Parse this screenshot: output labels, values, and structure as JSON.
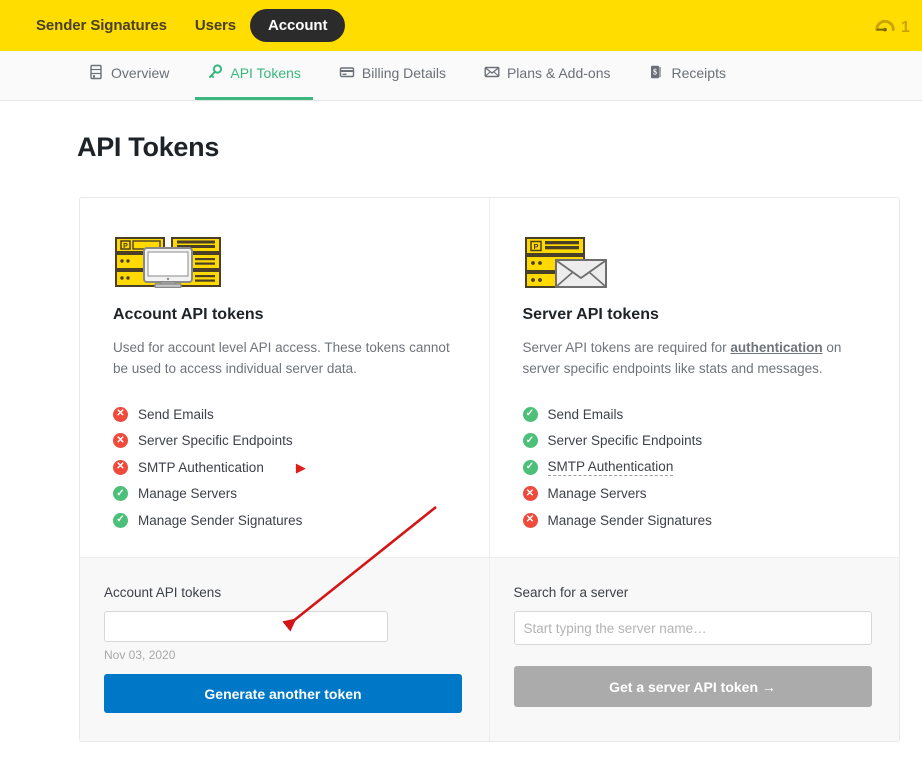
{
  "topbar": {
    "items": [
      {
        "label": "Sender Signatures",
        "active": false
      },
      {
        "label": "Users",
        "active": false
      },
      {
        "label": "Account",
        "active": true
      }
    ],
    "gauge_icon": "gauge-icon",
    "count": "1",
    "bg_color": "#ffdd00",
    "active_pill_color": "#2b2b2b"
  },
  "subnav": {
    "items": [
      {
        "label": "Overview",
        "icon": "server-icon",
        "active": false
      },
      {
        "label": "API Tokens",
        "icon": "key-icon",
        "active": true
      },
      {
        "label": "Billing Details",
        "icon": "credit-card-icon",
        "active": false
      },
      {
        "label": "Plans & Add-ons",
        "icon": "envelope-icon",
        "active": false
      },
      {
        "label": "Receipts",
        "icon": "receipt-icon",
        "active": false
      }
    ],
    "active_color": "#3ab77e"
  },
  "page": {
    "title": "API Tokens"
  },
  "cards": {
    "account": {
      "icon": "servers-with-monitor-icon",
      "title": "Account API tokens",
      "description": "Used for account level API access. These tokens cannot be used to access individual server data.",
      "features": [
        {
          "label": "Send Emails",
          "allowed": false
        },
        {
          "label": "Server Specific Endpoints",
          "allowed": false
        },
        {
          "label": "SMTP Authentication",
          "allowed": false,
          "marker": "▶"
        },
        {
          "label": "Manage Servers",
          "allowed": true
        },
        {
          "label": "Manage Sender Signatures",
          "allowed": true
        }
      ],
      "form": {
        "label": "Account API tokens",
        "token_value": "",
        "token_placeholder": "",
        "date": "Nov 03, 2020",
        "button_label": "Generate another token",
        "button_color": "#0078c8"
      }
    },
    "server": {
      "icon": "servers-with-envelope-icon",
      "title": "Server API tokens",
      "description_before": "Server API tokens are required for ",
      "description_link": "authentication",
      "description_after": " on server specific endpoints like stats and messages.",
      "features": [
        {
          "label": "Send Emails",
          "allowed": true
        },
        {
          "label": "Server Specific Endpoints",
          "allowed": true
        },
        {
          "label": "SMTP Authentication",
          "allowed": true,
          "dotted": true
        },
        {
          "label": "Manage Servers",
          "allowed": false
        },
        {
          "label": "Manage Sender Signatures",
          "allowed": false
        }
      ],
      "form": {
        "label": "Search for a server",
        "search_value": "",
        "search_placeholder": "Start typing the server name…",
        "button_label": "Get a server API token →",
        "button_color": "#ababab"
      }
    }
  },
  "annotations": {
    "arrow_color": "#d41515",
    "marker_color": "#e21b1b"
  },
  "icons": {
    "yes_glyph": "✔",
    "no_glyph": "✕"
  }
}
